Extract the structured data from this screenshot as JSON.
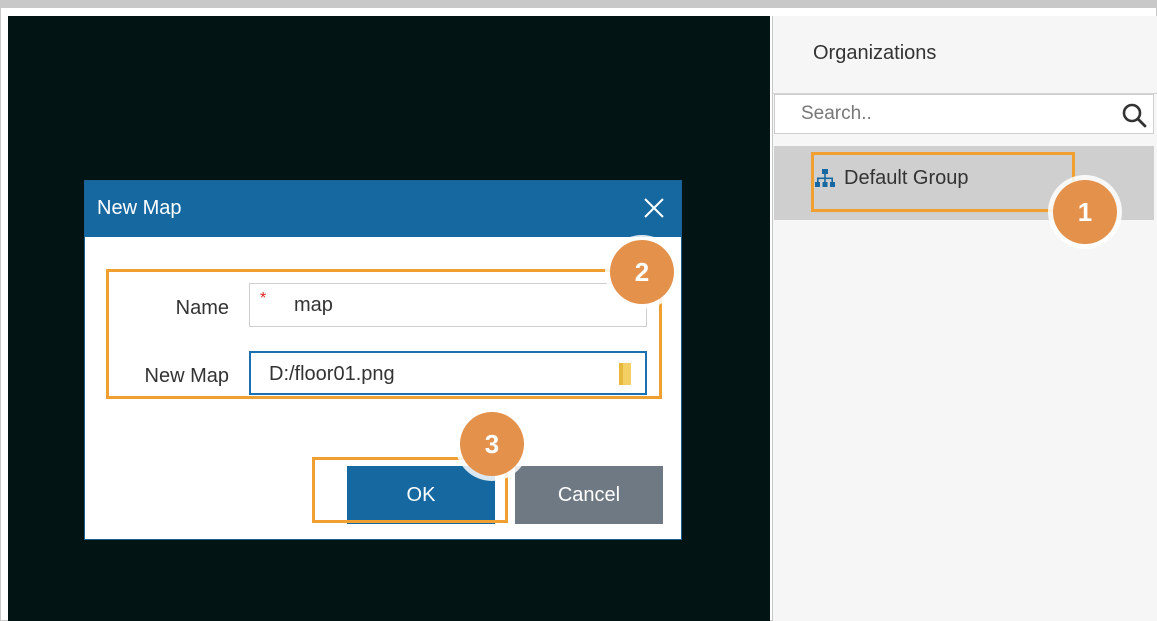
{
  "sidebar": {
    "title": "Organizations",
    "search": {
      "placeholder": "Search.."
    },
    "tree": [
      {
        "label": "Default Group"
      }
    ]
  },
  "dialog": {
    "title": "New Map",
    "fields": {
      "name": {
        "label": "Name",
        "value": "map",
        "required_mark": "*"
      },
      "new_map": {
        "label": "New Map",
        "value": "D:/floor01.png"
      }
    },
    "buttons": {
      "ok": "OK",
      "cancel": "Cancel"
    }
  },
  "steps": [
    "1",
    "2",
    "3"
  ],
  "colors": {
    "map_background": "#031414",
    "dialog_header": "#1668a1",
    "highlight": "#f0a030",
    "step_badge": "#e4914b"
  }
}
